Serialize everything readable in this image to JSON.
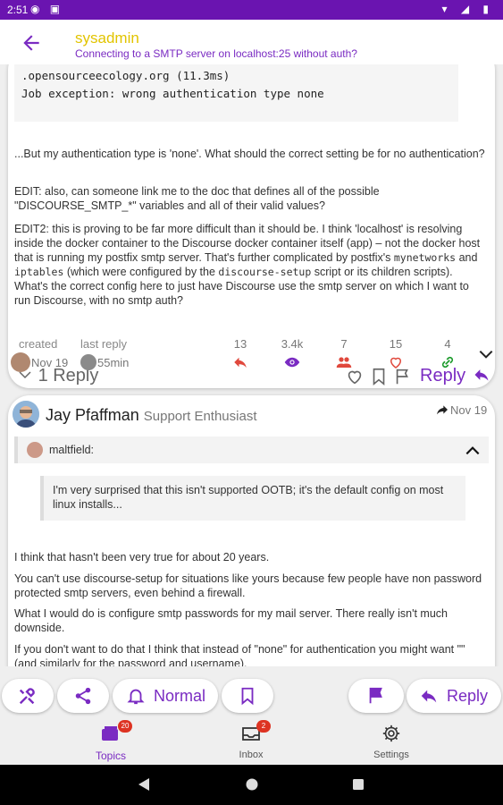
{
  "status": {
    "time": "2:51"
  },
  "appbar": {
    "username": "sysadmin",
    "topic_title": "Connecting to a SMTP server on localhost:25 without auth?"
  },
  "post1": {
    "code_lines": [
      ".opensourceecology.org (11.3ms)",
      "Job exception: wrong authentication type none"
    ],
    "p1": "...But my authentication type is 'none'. What should the correct setting be for no authentication?",
    "p2": "EDIT: also, can someone link me to the doc that defines all of the possible \"DISCOURSE_SMTP_*\" variables and all of their valid values?",
    "p3_a": "EDIT2: this is proving to be far more difficult than it should be. I think 'localhost' is resolving inside the docker container to the Discourse docker container itself (app) – not the docker host that is running my postfix smtp server. That's further complicated by postfix's ",
    "p3_code1": "mynetworks",
    "p3_b": " and ",
    "p3_code2": "iptables",
    "p3_c": " (which were configured by the ",
    "p3_code3": "discourse-setup",
    "p3_d": " script or its children scripts). What's the correct config here to just have Discourse use the smtp server on which I want to run Discourse, with no smtp auth?",
    "replies_label": "1 Reply",
    "reply_label": "Reply"
  },
  "meta": {
    "created_label": "created",
    "created_date": "Nov 19",
    "last_reply_label": "last reply",
    "last_reply_date": "55min",
    "counts": {
      "replies": "13",
      "views": "3.4k",
      "users": "7",
      "likes": "15",
      "links": "4"
    }
  },
  "post2": {
    "author": "Jay Pfaffman",
    "author_title": "Support Enthusiast",
    "date": "Nov 19",
    "quote_user": "maltfield:",
    "quote_text": "I'm very surprised that this isn't supported OOTB; it's the default config on most linux installs...",
    "r1": "I think that hasn't been very true for about 20 years.",
    "r2": "You can't use discourse-setup for situations like yours because few people have non password protected smtp servers, even behind a firewall.",
    "r3": "What I would do is configure smtp passwords for my mail server. There really isn't much downside.",
    "r4": "If you don't want to do that I think that instead of \"none\" for authentication you might want \"\" (and similarly for the password and username)."
  },
  "bottom": {
    "notification_label": "Normal",
    "reply_label": "Reply"
  },
  "tabs": {
    "topics": {
      "label": "Topics",
      "badge": "20"
    },
    "inbox": {
      "label": "Inbox",
      "badge": "2"
    },
    "settings": {
      "label": "Settings"
    }
  },
  "colors": {
    "accent": "#7a2bc2",
    "statusbar": "#6a14b0",
    "username": "#e2c400",
    "like_red": "#e0483c"
  }
}
